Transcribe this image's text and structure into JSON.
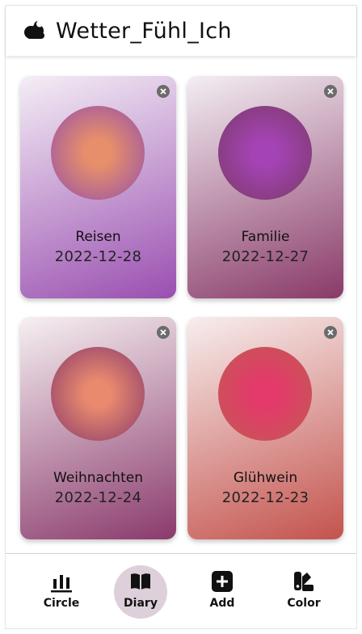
{
  "app": {
    "title": "Wetter_Fühl_Ich",
    "logo_icon": "cloud-moon-icon"
  },
  "cards": [
    {
      "name": "Reisen",
      "date": "2022-12-28",
      "bg_top": "#f4eef6",
      "bg_bottom": "#9a4fb0",
      "circle_center": "#e78f6a",
      "circle_edge": "#9550a8"
    },
    {
      "name": "Familie",
      "date": "2022-12-27",
      "bg_top": "#f3eef3",
      "bg_bottom": "#893a68",
      "circle_center": "#a443b4",
      "circle_edge": "#7a3a66"
    },
    {
      "name": "Weihnachten",
      "date": "2022-12-24",
      "bg_top": "#f6f0f2",
      "bg_bottom": "#8a3a6c",
      "circle_center": "#e98a6e",
      "circle_edge": "#8a3a6c"
    },
    {
      "name": "Glühwein",
      "date": "2022-12-23",
      "bg_top": "#f7eeee",
      "bg_bottom": "#c4534d",
      "circle_center": "#e33a6a",
      "circle_edge": "#c25a52"
    }
  ],
  "close_icon": "close-icon",
  "nav": {
    "circle": {
      "label": "Circle",
      "icon": "bar-chart-icon"
    },
    "diary": {
      "label": "Diary",
      "icon": "book-icon",
      "active": true
    },
    "add": {
      "label": "Add",
      "icon": "plus-square-icon"
    },
    "color": {
      "label": "Color",
      "icon": "swatch-icon"
    }
  },
  "colors": {
    "active_nav_bg": "#ddd0da",
    "close_bg": "#6b6b6b",
    "text": "#111111"
  }
}
